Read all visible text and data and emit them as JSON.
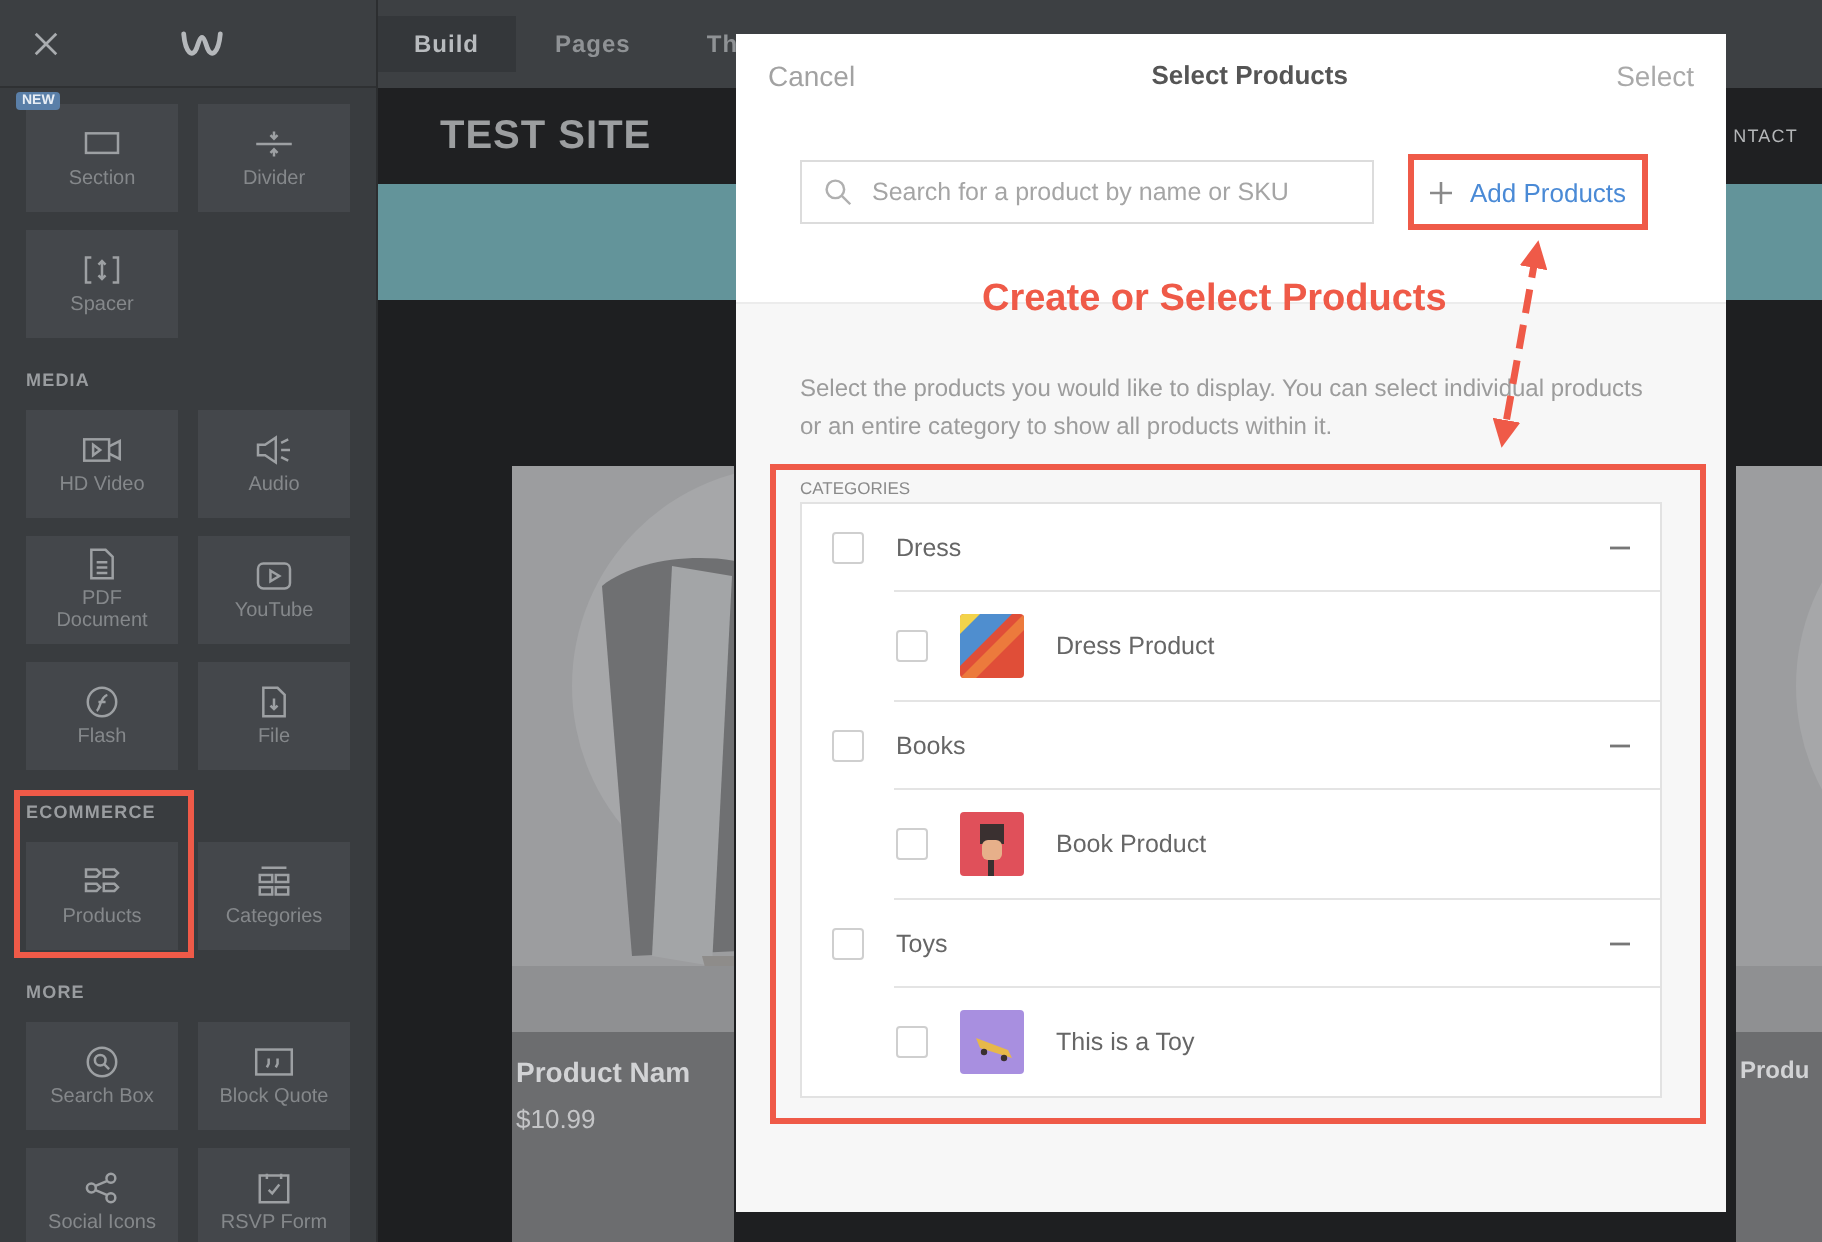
{
  "sidebar": {
    "sections": [
      {
        "items": [
          {
            "label": "Section",
            "badge": "NEW",
            "highlighted": false
          },
          {
            "label": "Divider",
            "highlighted": false
          },
          {
            "label": "Spacer",
            "highlighted": false
          }
        ]
      },
      {
        "title": "MEDIA",
        "items": [
          {
            "label": "HD Video",
            "highlighted": false
          },
          {
            "label": "Audio",
            "highlighted": false
          },
          {
            "label": "PDF Document",
            "highlighted": false
          },
          {
            "label": "YouTube",
            "highlighted": false
          },
          {
            "label": "Flash",
            "highlighted": false
          },
          {
            "label": "File",
            "highlighted": false
          }
        ]
      },
      {
        "title": "ECOMMERCE",
        "items": [
          {
            "label": "Products",
            "highlighted": true
          },
          {
            "label": "Categories",
            "highlighted": false
          }
        ]
      },
      {
        "title": "MORE",
        "items": [
          {
            "label": "Search Box",
            "highlighted": false
          },
          {
            "label": "Block Quote",
            "highlighted": false
          },
          {
            "label": "Social Icons",
            "highlighted": false
          },
          {
            "label": "RSVP Form",
            "highlighted": false
          }
        ]
      }
    ]
  },
  "topbar": {
    "tabs": [
      {
        "label": "Build",
        "selected": true
      },
      {
        "label": "Pages",
        "selected": false
      },
      {
        "label": "Th",
        "selected": false
      }
    ]
  },
  "site": {
    "title": "TEST SITE",
    "nav": [
      "NTACT"
    ],
    "cards": [
      {
        "name": "Product Nam",
        "price": "$10.99"
      },
      {
        "name": "Produ"
      }
    ]
  },
  "modal": {
    "cancel": "Cancel",
    "title": "Select Products",
    "confirm": {
      "label": "Select",
      "disabled": true
    },
    "search": {
      "placeholder": "Search for a product by name or SKU"
    },
    "add_button": {
      "label": "Add Products",
      "highlighted": true
    },
    "description": "Select the products you would like to display. You can select individual products or an entire category to show all products within it.",
    "categories_label": "CATEGORIES",
    "categories_highlighted": true,
    "categories": [
      {
        "name": "Dress",
        "checked": false,
        "expanded": true,
        "children": [
          {
            "name": "Dress Product",
            "checked": false
          }
        ]
      },
      {
        "name": "Books",
        "checked": false,
        "expanded": true,
        "children": [
          {
            "name": "Book Product",
            "checked": false
          }
        ]
      },
      {
        "name": "Toys",
        "checked": false,
        "expanded": true,
        "children": [
          {
            "name": "This is a Toy",
            "checked": false
          }
        ]
      }
    ]
  },
  "callout": "Create or Select Products"
}
